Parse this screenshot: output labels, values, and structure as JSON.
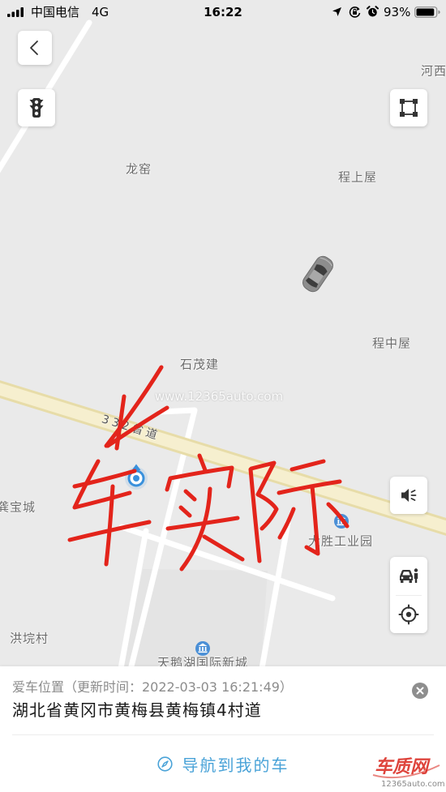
{
  "status_bar": {
    "carrier": "中国电信",
    "network": "4G",
    "time": "16:22",
    "battery_text": "93%",
    "battery_level": 0.93,
    "icons": {
      "signal": "signal-icon",
      "location": "location-arrow-icon",
      "orientation_lock": "orientation-lock-icon",
      "alarm": "alarm-clock-icon",
      "battery": "battery-icon"
    }
  },
  "map": {
    "controls": {
      "back": "chevron-left-icon",
      "traffic": "traffic-light-icon",
      "overview": "fit-view-icon",
      "voice": "speaker-icon",
      "find_car": "car-person-icon",
      "locate": "crosshair-icon"
    },
    "places": [
      "河西",
      "龙窑",
      "程上屋",
      "程中屋",
      "石茂建",
      "龚宝城",
      "大胜工业园",
      "洪垸村",
      "天鹅湖国际新城"
    ],
    "road_label": "332省道",
    "watermark": "www.12365auto.com",
    "annotation": {
      "text": "车实际",
      "color": "#e3241b"
    },
    "colors": {
      "background": "#eaeaea",
      "provincial_road": "#f6efcf",
      "location_dot": "#3a91dc",
      "poi": "#4a8fd6",
      "car_marker": "#8d8d8d"
    }
  },
  "panel": {
    "title": "爱车位置（更新时间：2022-03-03 16:21:49）",
    "address": "湖北省黄冈市黄梅县黄梅镇4村道",
    "close_icon": "close-circle-icon",
    "nav_icon": "compass-icon",
    "nav_label": "导航到我的车",
    "accent": "#4aa3d8"
  },
  "logo": {
    "name": "车质网",
    "site": "12365auto.com",
    "color": "#d9241b"
  }
}
